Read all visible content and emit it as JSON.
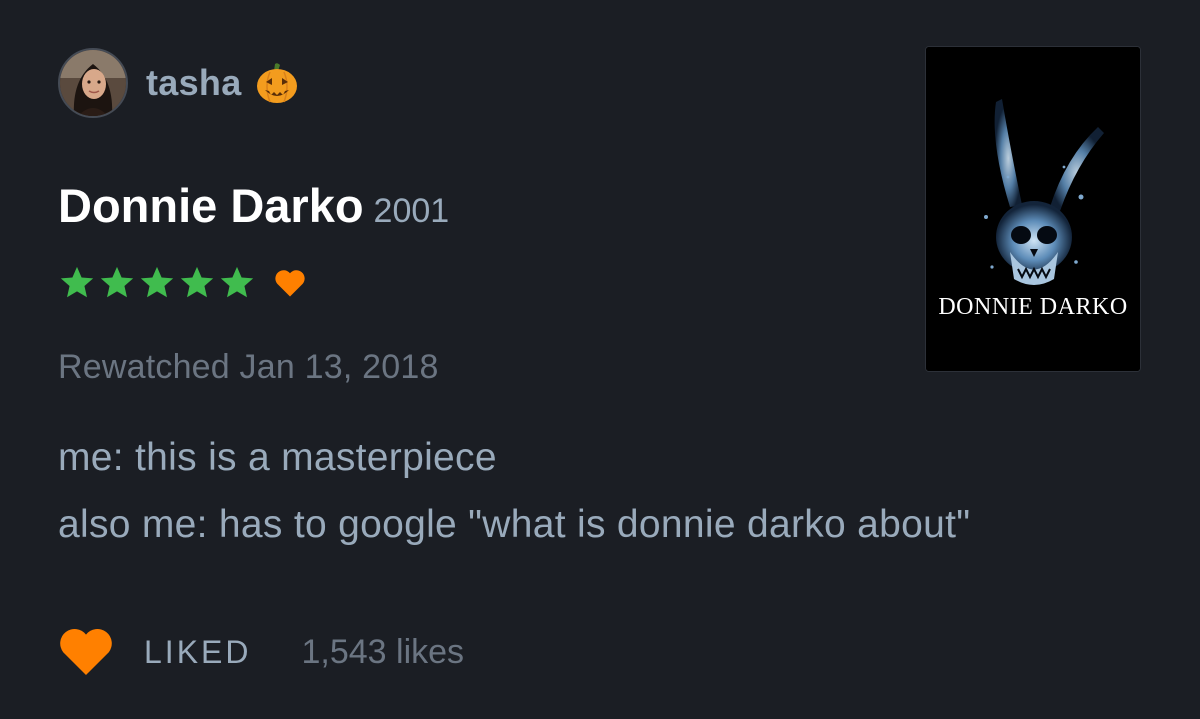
{
  "review": {
    "author": {
      "username": "tasha",
      "avatar_icon": "user-avatar-photo",
      "badge_icon": "pumpkin-icon"
    },
    "film": {
      "title": "Donnie Darko",
      "year": "2001",
      "poster_title": "DONNIE DARKO",
      "poster_icon": "skull-rabbit-art"
    },
    "rating": {
      "stars": 5,
      "max_stars": 5,
      "star_color": "#40bc4e",
      "liked": true,
      "heart_color": "#ff8000"
    },
    "watched_text": "Rewatched Jan 13, 2018",
    "body_lines": [
      "me: this is a masterpiece",
      "also me: has to google \"what is donnie darko about\""
    ],
    "footer": {
      "liked_label": "LIKED",
      "likes_count": "1,543 likes"
    }
  }
}
